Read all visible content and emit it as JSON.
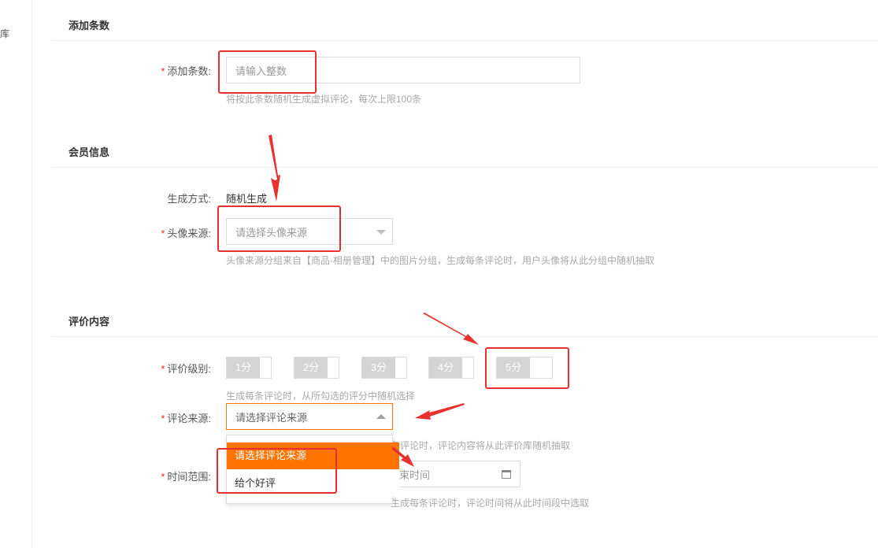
{
  "left_rail": {
    "char": "库"
  },
  "sections": {
    "add_count": "添加条数",
    "member": "会员信息",
    "review": "评价内容"
  },
  "add_count": {
    "label": "添加条数:",
    "placeholder": "请输入整数",
    "hint": "将按此条数随机生成虚拟评论，每次上限100条"
  },
  "member": {
    "gen_label": "生成方式:",
    "gen_value": "随机生成",
    "avatar_label": "头像来源:",
    "avatar_placeholder": "请选择头像来源",
    "avatar_hint": "头像来源分组来自【商品-相册管理】中的图片分组，生成每条评论时，用户头像将从此分组中随机抽取"
  },
  "review": {
    "level_label": "评价级别:",
    "scores": [
      "1分",
      "2分",
      "3分",
      "4分",
      "5分"
    ],
    "level_hint": "生成每条评论时，从所勾选的评分中随机选择",
    "source_label": "评论来源:",
    "source_placeholder": "请选择评论来源",
    "source_hint_visible": "条评论时，评论内容将从此评价库随机抽取",
    "dropdown_options": [
      "请选择评论来源",
      "给个好评"
    ],
    "time_label": "时间范围:",
    "end_time_placeholder": "结束时间",
    "time_hint_visible": "生成每条评论时，评论时间将从此时间段中选取"
  },
  "colors": {
    "accent": "#ff7300",
    "annotation": "#e8312f",
    "required": "#f5222d"
  },
  "icons": {
    "select_caret": "chevron-down-icon",
    "calendar": "calendar-icon"
  }
}
